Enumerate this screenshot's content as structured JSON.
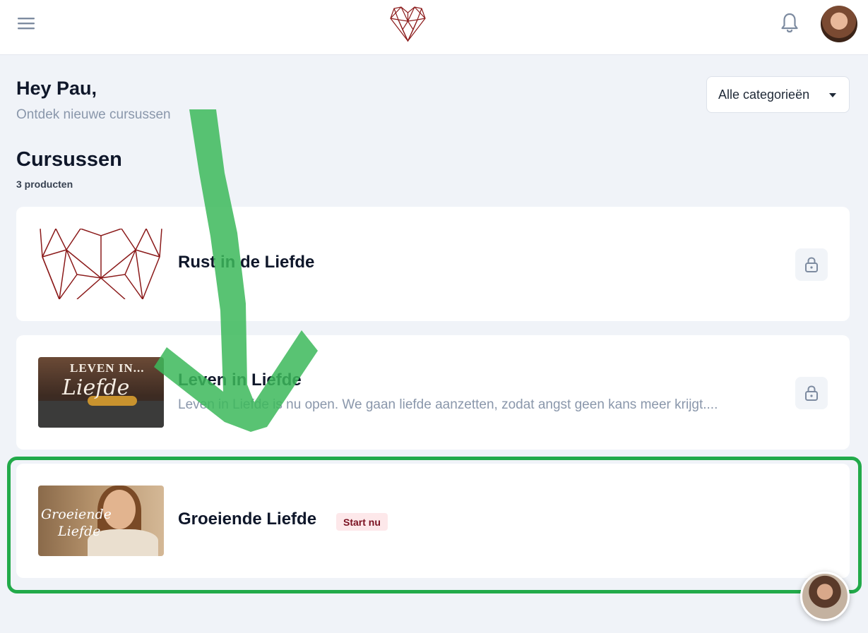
{
  "header": {
    "menu_icon": "hamburger-menu-icon",
    "logo_icon": "geometric-heart-logo",
    "notification_icon": "bell-icon",
    "avatar": "user-avatar"
  },
  "greeting": {
    "title": "Hey Pau,",
    "subtitle": "Ontdek nieuwe cursussen"
  },
  "filter": {
    "selected": "Alle categorieën"
  },
  "section": {
    "title": "Cursussen",
    "count": "3 producten"
  },
  "courses": [
    {
      "title": "Rust in de Liefde",
      "description": "",
      "locked": true,
      "thumbnail": "geometric-heart"
    },
    {
      "title": "Leven in Liefde",
      "description": "Leven in Liefde is nu open. We gaan liefde aanzetten, zodat angst geen kans meer krijgt....",
      "locked": true,
      "thumbnail_text_1": "LEVEN IN...",
      "thumbnail_text_2": "Liefde"
    },
    {
      "title": "Groeiende Liefde",
      "badge": "Start nu",
      "locked": false,
      "thumbnail_text_1": "Groeiende",
      "thumbnail_text_2": "Liefde"
    }
  ],
  "colors": {
    "brand": "#8b1a1a",
    "annotation_green": "#22aa4a",
    "badge_bg": "#fde8ea",
    "badge_text": "#7a1020"
  },
  "chat_widget": "chat-avatar-button"
}
